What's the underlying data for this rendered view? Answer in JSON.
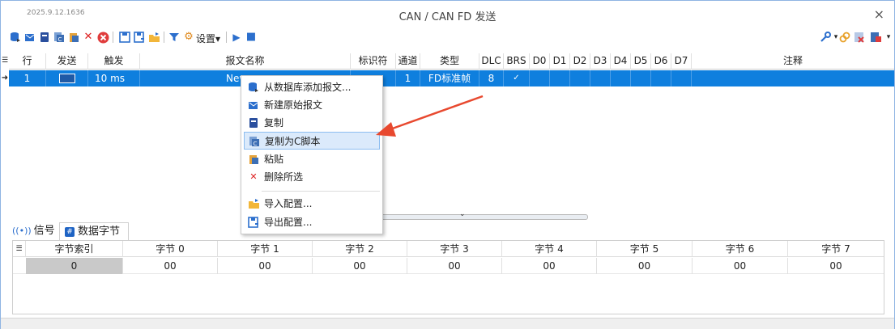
{
  "window": {
    "version": "2025.9.12.1636",
    "title": "CAN / CAN FD 发送",
    "close_glyph": "×"
  },
  "toolbar": {
    "settings_label": "设置",
    "settings_caret": "▾",
    "play_glyph": "▶",
    "stop_glyph": "■",
    "right_dropdown_caret": "▾"
  },
  "grid": {
    "columns": [
      "行",
      "发送",
      "触发",
      "报文名称",
      "标识符",
      "通道",
      "类型",
      "DLC",
      "BRS",
      "D0",
      "D1",
      "D2",
      "D3",
      "D4",
      "D5",
      "D6",
      "D7",
      "注释"
    ],
    "rows": [
      {
        "marker": "➜",
        "line": "1",
        "trigger": "10 ms",
        "name": "New",
        "identifier": "",
        "channel": "1",
        "type": "FD标准帧",
        "dlc": "8",
        "brs": "✓"
      }
    ]
  },
  "context_menu": {
    "items": [
      {
        "label": "从数据库添加报文...",
        "icon": "database-add-icon"
      },
      {
        "label": "新建原始报文",
        "icon": "new-message-icon"
      },
      {
        "label": "复制",
        "icon": "copy-icon"
      },
      {
        "label": "复制为C脚本",
        "icon": "copy-c-script-icon"
      },
      {
        "label": "粘贴",
        "icon": "paste-icon"
      },
      {
        "label": "删除所选",
        "icon": "delete-icon"
      },
      {
        "label": "导入配置...",
        "icon": "import-icon"
      },
      {
        "label": "导出配置...",
        "icon": "export-icon"
      }
    ],
    "highlighted_index": 3
  },
  "bottom_tabs": [
    {
      "label": "信号",
      "icon": "signal-icon"
    },
    {
      "label": "数据字节",
      "icon": "data-bytes-icon"
    }
  ],
  "bytes_table": {
    "columns": [
      "字节索引",
      "字节 0",
      "字节 1",
      "字节 2",
      "字节 3",
      "字节 4",
      "字节 5",
      "字节 6",
      "字节 7"
    ],
    "row": [
      "0",
      "00",
      "00",
      "00",
      "00",
      "00",
      "00",
      "00",
      "00"
    ]
  },
  "colors": {
    "selection": "#0f7fde",
    "menu_highlight": "#dbeafb",
    "arrow": "#e8492f"
  }
}
